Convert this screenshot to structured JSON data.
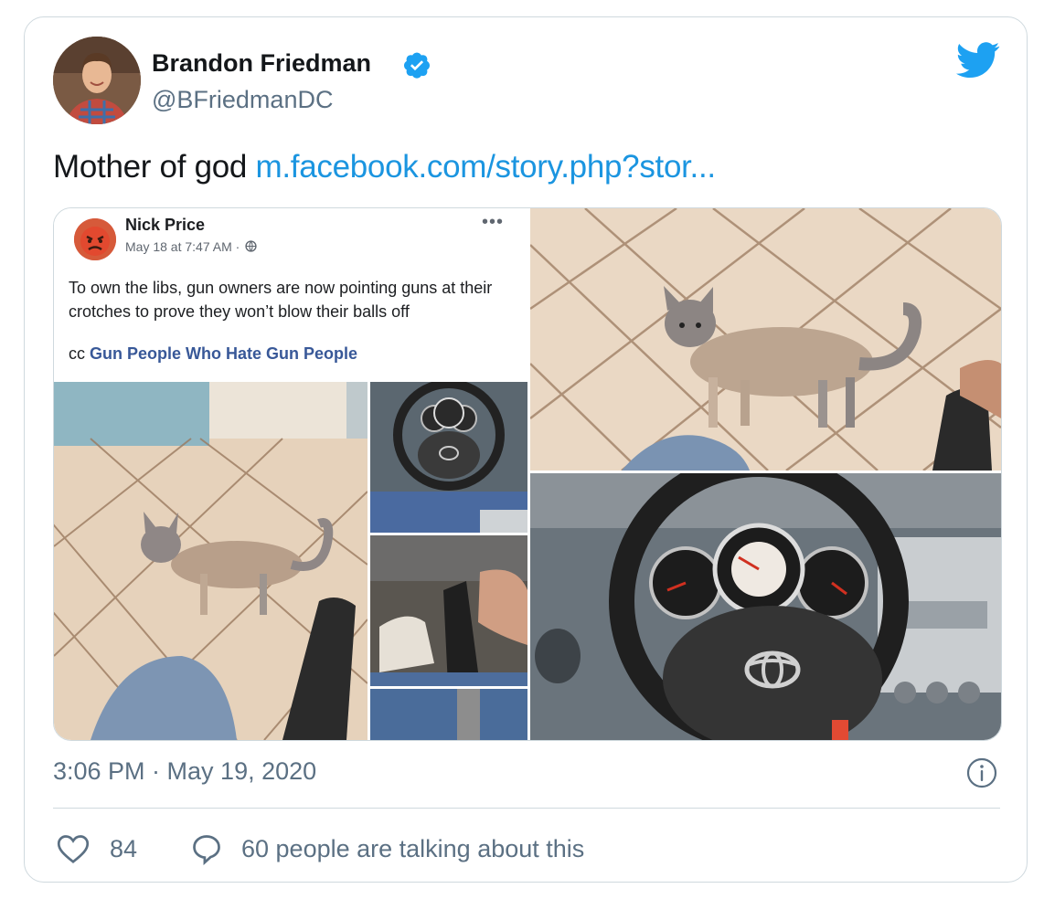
{
  "tweet": {
    "author_name": "Brandon Friedman",
    "author_handle": "@BFriedmanDC",
    "text": "Mother of god",
    "link_text": "m.facebook.com/story.php?stor...",
    "timestamp": "3:06 PM · May 19, 2020",
    "likes": "84",
    "talking": "60 people are talking about this"
  },
  "embedded_post": {
    "author": "Nick Price",
    "meta": "May 18 at 7:47 AM ·",
    "more": "•••",
    "body": "To own the libs, gun owners are now pointing guns at their crotches to prove they won’t blow their balls off",
    "cc_prefix": "cc",
    "cc_link": "Gun People Who Hate Gun People"
  },
  "icons": {
    "verified": "verified-badge-icon",
    "brand": "twitter-bird-icon",
    "info": "info-icon",
    "like": "heart-icon",
    "reply": "speech-bubble-icon",
    "globe": "globe-icon"
  },
  "colors": {
    "link": "#1b95e0",
    "secondary_text": "#5b7083",
    "fb_link": "#385898",
    "border": "#cfd9de"
  }
}
